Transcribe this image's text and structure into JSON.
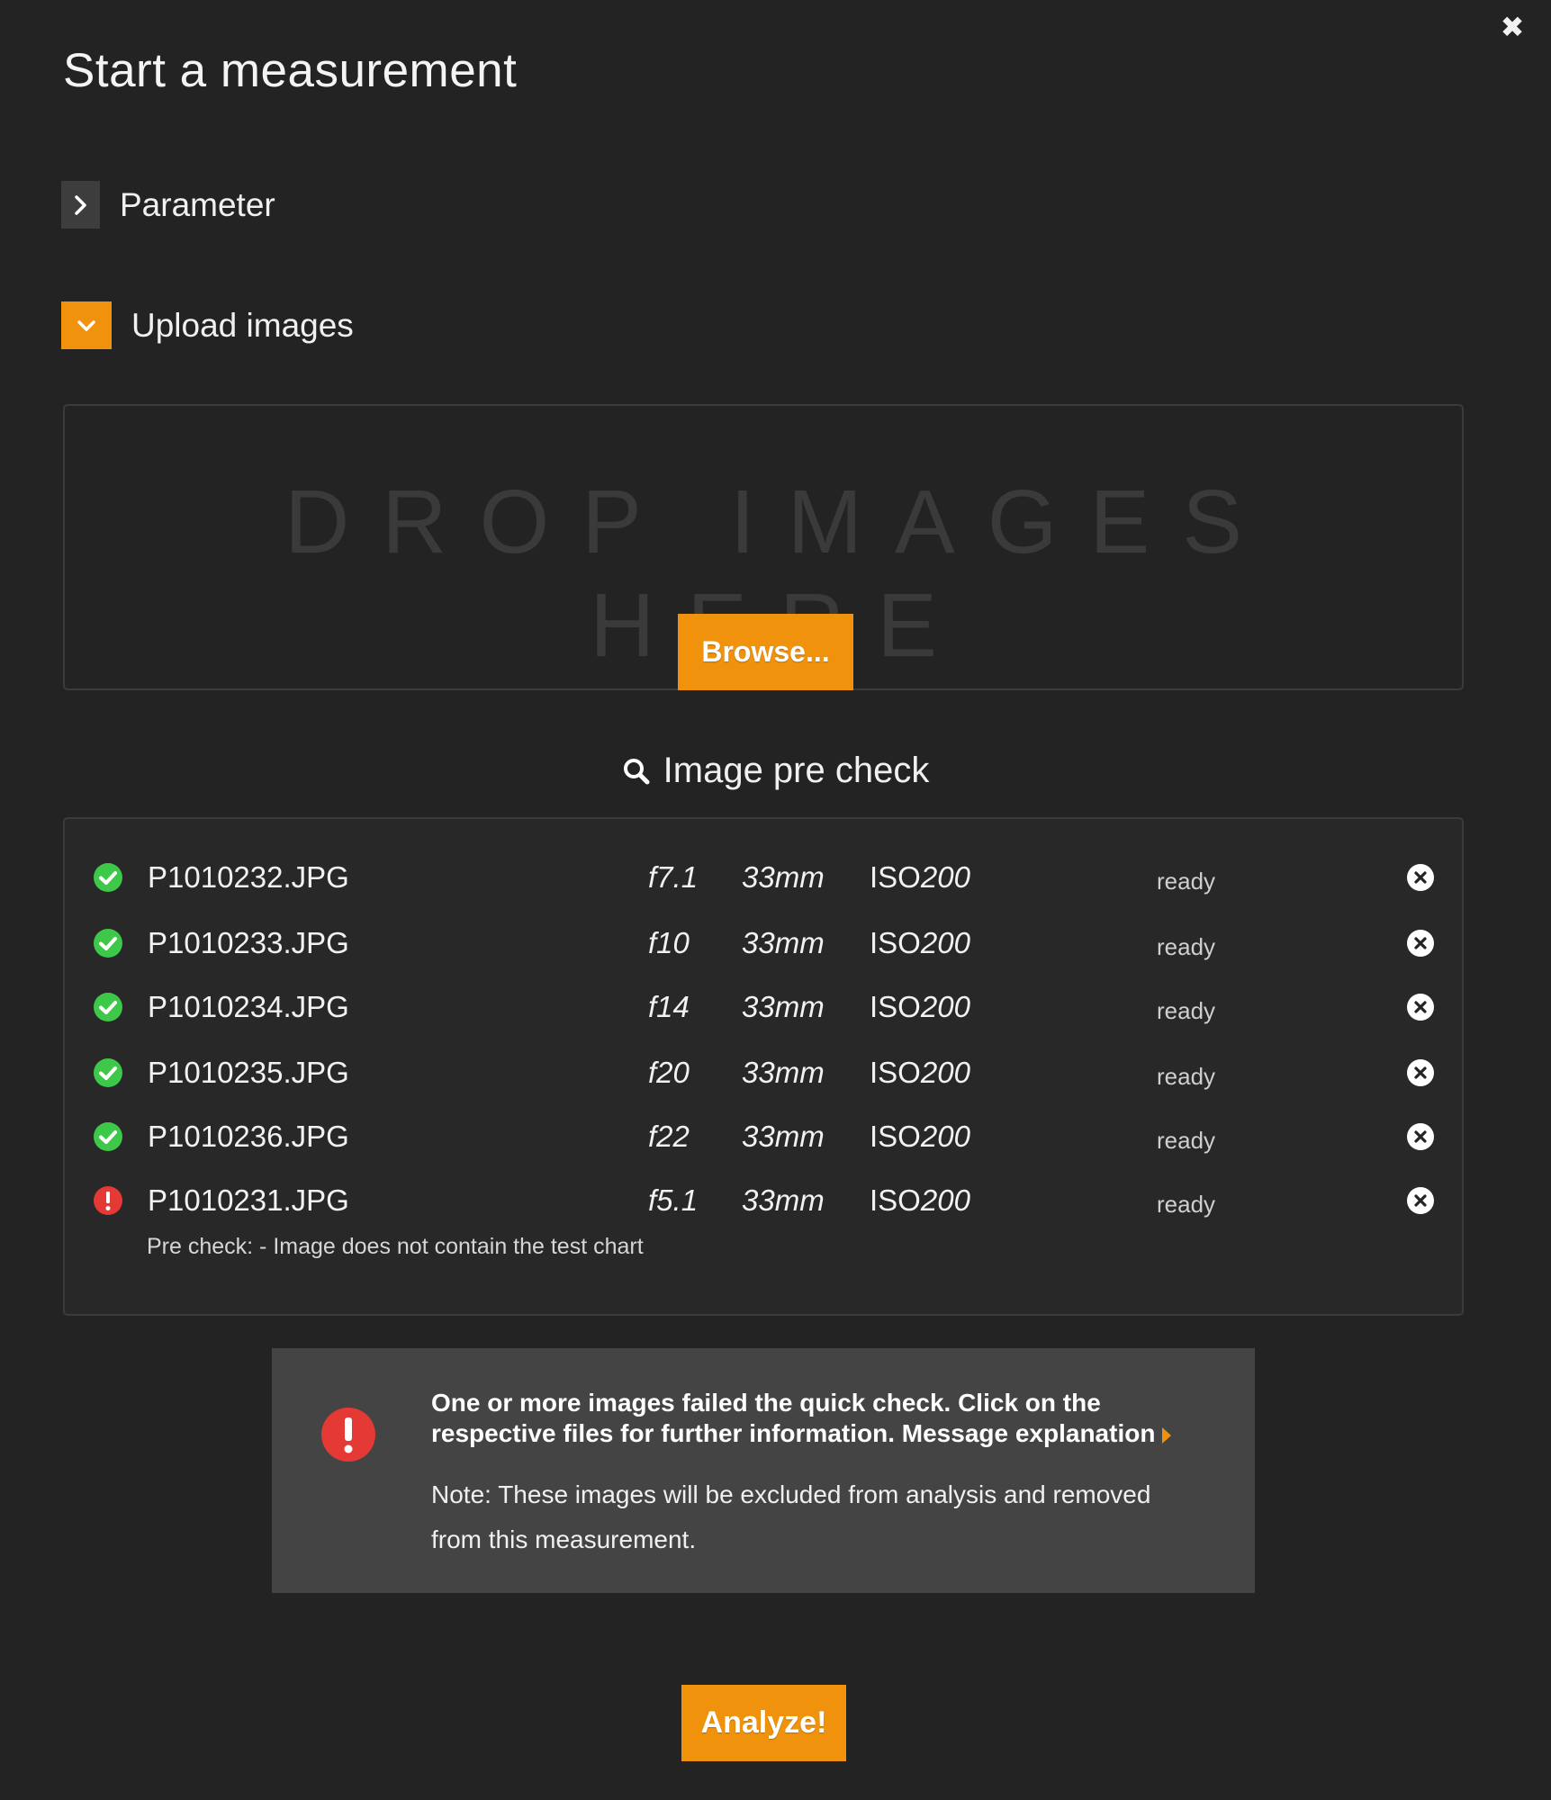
{
  "dialog": {
    "title": "Start a measurement",
    "close_symbol": "✖"
  },
  "sections": {
    "parameter": {
      "label": "Parameter",
      "expanded": false,
      "icon": "chevron-right-icon"
    },
    "upload": {
      "label": "Upload images",
      "expanded": true,
      "icon": "chevron-down-icon"
    }
  },
  "dropzone": {
    "text": "DROP IMAGES HERE",
    "browse_label": "Browse..."
  },
  "precheck": {
    "title": "Image pre check",
    "icon": "search-icon",
    "files": [
      {
        "status": "ok",
        "name": "P1010232.JPG",
        "aperture": "f7.1",
        "focal": "33mm",
        "iso_prefix": "ISO",
        "iso_value": "200",
        "state": "ready"
      },
      {
        "status": "ok",
        "name": "P1010233.JPG",
        "aperture": "f10",
        "focal": "33mm",
        "iso_prefix": "ISO",
        "iso_value": "200",
        "state": "ready"
      },
      {
        "status": "ok",
        "name": "P1010234.JPG",
        "aperture": "f14",
        "focal": "33mm",
        "iso_prefix": "ISO",
        "iso_value": "200",
        "state": "ready"
      },
      {
        "status": "ok",
        "name": "P1010235.JPG",
        "aperture": "f20",
        "focal": "33mm",
        "iso_prefix": "ISO",
        "iso_value": "200",
        "state": "ready"
      },
      {
        "status": "ok",
        "name": "P1010236.JPG",
        "aperture": "f22",
        "focal": "33mm",
        "iso_prefix": "ISO",
        "iso_value": "200",
        "state": "ready"
      },
      {
        "status": "error",
        "name": "P1010231.JPG",
        "aperture": "f5.1",
        "focal": "33mm",
        "iso_prefix": "ISO",
        "iso_value": "200",
        "state": "ready"
      }
    ],
    "error_note": "Pre check: - Image does not contain the test chart"
  },
  "alert": {
    "message": "One or more images failed the quick check. Click on the respective files for further information.",
    "link_label": "Message explanation",
    "note": "Note: These images will be excluded from analysis and removed from this measurement."
  },
  "actions": {
    "analyze_label": "Analyze!"
  },
  "colors": {
    "background": "#232323",
    "accent": "#f0920b",
    "ok": "#3ec84a",
    "error": "#e53935",
    "alert_bg": "#444444"
  }
}
